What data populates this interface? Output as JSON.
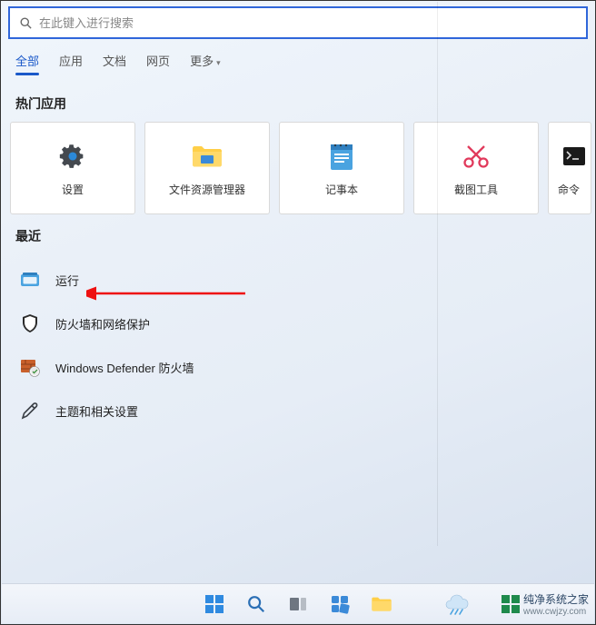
{
  "search": {
    "placeholder": "在此键入进行搜索"
  },
  "tabs": {
    "all": "全部",
    "apps": "应用",
    "docs": "文档",
    "web": "网页",
    "more": "更多"
  },
  "sections": {
    "hot_apps": "热门应用",
    "recent": "最近"
  },
  "hot_apps": [
    {
      "label": "设置",
      "icon": "settings"
    },
    {
      "label": "文件资源管理器",
      "icon": "explorer"
    },
    {
      "label": "记事本",
      "icon": "notepad"
    },
    {
      "label": "截图工具",
      "icon": "snip"
    },
    {
      "label": "命令",
      "icon": "terminal"
    }
  ],
  "recent": [
    {
      "label": "运行",
      "icon": "run"
    },
    {
      "label": "防火墙和网络保护",
      "icon": "shield"
    },
    {
      "label": "Windows Defender 防火墙",
      "icon": "defender"
    },
    {
      "label": "主题和相关设置",
      "icon": "pen"
    }
  ],
  "watermark": {
    "line1": "纯净系统之家",
    "line2": "www.cwjzy.com"
  }
}
